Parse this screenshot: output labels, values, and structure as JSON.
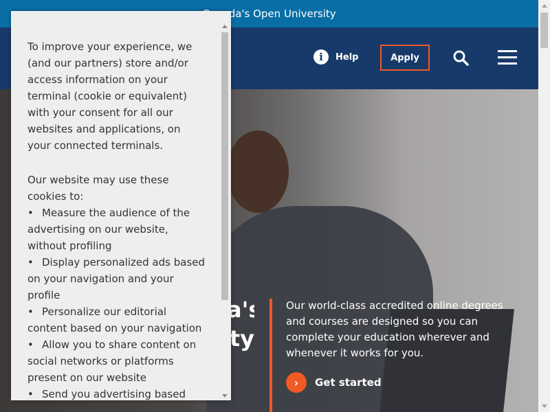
{
  "topbar": {
    "text": "Canada's Open University"
  },
  "header": {
    "help_label": "Help",
    "apply_label": "Apply",
    "icons": [
      "info-icon",
      "search-icon",
      "menu-icon"
    ],
    "accent_color": "#f05a24",
    "bg_color": "#173a6b"
  },
  "hero": {
    "title_lines": [
      "a's",
      "ty"
    ],
    "description": "Our world-class accredited online degrees and courses are designed so you can complete your education wherever and whenever it works for you.",
    "cta_label": "Get started"
  },
  "cookie_dialog": {
    "intro": "To improve your experience, we (and our partners) store and/or access information on your terminal (cookie or equivalent) with your consent for all our websites and applications, on your connected terminals.",
    "lead": "Our website may use these cookies to:",
    "items": [
      "Measure the audience of the advertising on our website, without profiling",
      "Display personalized ads based on your navigation and your profile",
      "Personalize our editorial content based on your navigation",
      "Allow you to share content on social networks or platforms present on our website",
      "Send you advertising based"
    ]
  }
}
